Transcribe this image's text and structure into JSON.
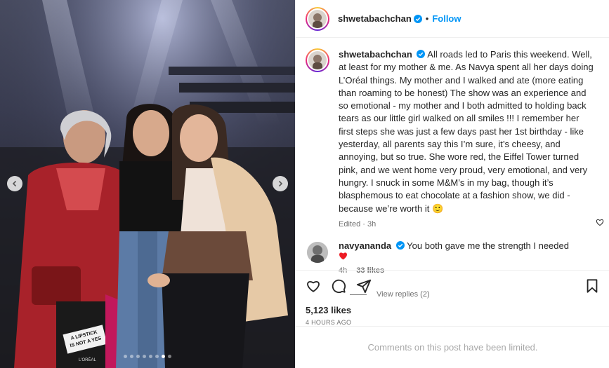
{
  "post": {
    "author": "shwetabachchan",
    "follow_label": "Follow",
    "separator": "•",
    "caption": "All roads led to Paris this weekend. Well, at least for my mother & me. As Navya spent all her days doing L’Oréal things. My mother and I walked and ate (more eating than roaming to be honest) The show was an experience and so emotional - my mother and I both admitted to holding back tears as our little girl walked on all smiles !!! I remember her first steps she was just a few days past her 1st birthday - like yesterday, all parents say this I’m sure, it’s cheesy, and annoying, but so true. She wore red, the Eiffel Tower turned pink, and we went home very proud, very emotional, and very hungry. I snuck in some M&M’s in my bag, though it’s blasphemous to eat chocolate at a fashion show, we did - because we’re worth it",
    "caption_emoji": "🙂",
    "edited_label": "Edited",
    "edited_dot": "·",
    "edited_time": "3h",
    "likes": "5,123 likes",
    "timestamp": "4 HOURS AGO",
    "comments_limited": "Comments on this post have been limited."
  },
  "reply": {
    "author": "navyananda",
    "text": "You both gave me the strength I needed",
    "time": "4h",
    "likes": "33 likes",
    "view_replies": "View replies (2)"
  },
  "photo": {
    "bag_text_line1": "A LIPSTICK",
    "bag_text_line2": "IS NOT A YES",
    "bag_brand": "L'ORÉAL",
    "carousel_total": 8,
    "carousel_active": 7
  },
  "colors": {
    "accent": "#0095f6",
    "heart": "#ed4956",
    "secondary_text": "#737373"
  },
  "icons": [
    "verified-badge-icon",
    "heart-icon",
    "comment-icon",
    "share-icon",
    "bookmark-icon",
    "chevron-left-icon",
    "chevron-right-icon"
  ]
}
